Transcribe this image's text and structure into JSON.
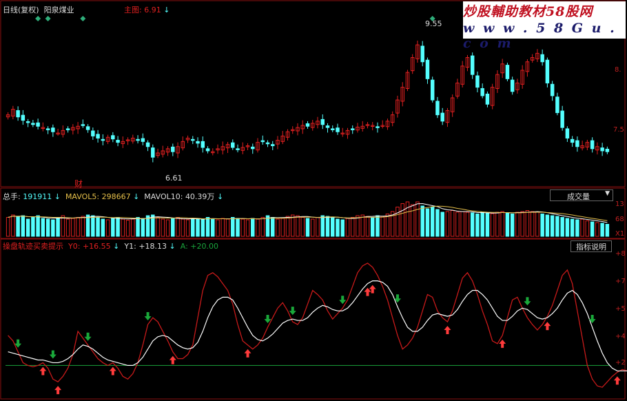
{
  "header": {
    "period": "日线(复权)",
    "stock_name": "阳泉煤业",
    "main_chart_label": "主图",
    "main_chart_value": "6.91",
    "cai_marker": "财"
  },
  "watermark": {
    "line1": "炒股輔助教材58股网",
    "line2": "w w w . 5 8 G u . c o m"
  },
  "price_panel": {
    "high_label": "9.55",
    "low_label": "6.61",
    "axis_labels": [
      "8.",
      "7.5"
    ]
  },
  "volume_panel": {
    "total_label": "总手:",
    "total_value": "191911",
    "mavol5_label": "MAVOL5:",
    "mavol5_value": "298667",
    "mavol10_label": "MAVOL10:",
    "mavol10_value": "40.39万",
    "dropdown_label": "成交量",
    "axis_labels": [
      "13",
      "68",
      "X1"
    ]
  },
  "indicator_panel": {
    "name": "操盘轨迹买卖提示",
    "y0_label": "Y0:",
    "y0_value": "+16.55",
    "y1_label": "Y1:",
    "y1_value": "+18.13",
    "a_label": "A:",
    "a_value": "+20.00",
    "button_label": "指标说明",
    "axis_labels": [
      "+8",
      "+7",
      "+5",
      "+4",
      "+2"
    ]
  },
  "colors": {
    "up": "#e02020",
    "down": "#54ffff",
    "y0_line": "#c81a1a",
    "y1_line": "#ffffff",
    "a_line": "#19a53c",
    "ma_line": "#ffffff",
    "buy_arrow": "#ff3b3b",
    "sell_arrow": "#1aa83a",
    "diamond": "#2fae7a"
  },
  "chart_data": {
    "type": "candlestick",
    "price_ylim": [
      6.3,
      10.2
    ],
    "close": [
      7.85,
      7.98,
      7.8,
      7.72,
      7.68,
      7.62,
      7.58,
      7.55,
      7.5,
      7.45,
      7.42,
      7.48,
      7.52,
      7.55,
      7.58,
      7.6,
      7.5,
      7.35,
      7.3,
      7.25,
      7.32,
      7.28,
      7.2,
      7.22,
      7.26,
      7.3,
      7.25,
      7.22,
      7.1,
      6.85,
      6.95,
      7.0,
      7.05,
      6.98,
      7.1,
      7.22,
      7.3,
      7.25,
      7.18,
      7.08,
      7.0,
      6.98,
      7.05,
      7.1,
      7.15,
      7.08,
      7.04,
      7.08,
      7.12,
      7.05,
      7.2,
      7.22,
      7.18,
      7.12,
      7.25,
      7.35,
      7.45,
      7.5,
      7.55,
      7.6,
      7.58,
      7.65,
      7.7,
      7.62,
      7.55,
      7.5,
      7.45,
      7.42,
      7.48,
      7.52,
      7.56,
      7.58,
      7.62,
      7.6,
      7.55,
      7.6,
      7.7,
      7.85,
      8.2,
      8.5,
      8.85,
      9.2,
      9.5,
      9.1,
      8.7,
      8.2,
      7.85,
      7.7,
      7.95,
      8.25,
      8.6,
      9.0,
      9.2,
      8.8,
      8.5,
      8.3,
      8.1,
      8.5,
      8.8,
      9.05,
      8.7,
      8.4,
      8.6,
      8.9,
      9.1,
      9.2,
      9.3,
      9.1,
      8.6,
      8.3,
      7.9,
      7.55,
      7.3,
      7.2,
      7.1,
      7.12,
      7.2,
      7.05,
      7.1,
      7.0,
      6.98
    ],
    "volume": [
      0.55,
      0.62,
      0.58,
      0.6,
      0.5,
      0.55,
      0.6,
      0.52,
      0.5,
      0.48,
      0.55,
      0.6,
      0.5,
      0.52,
      0.55,
      0.58,
      0.62,
      0.6,
      0.55,
      0.5,
      0.48,
      0.52,
      0.55,
      0.5,
      0.47,
      0.5,
      0.55,
      0.52,
      0.6,
      0.62,
      0.55,
      0.5,
      0.48,
      0.52,
      0.55,
      0.5,
      0.48,
      0.5,
      0.52,
      0.5,
      0.55,
      0.5,
      0.48,
      0.52,
      0.5,
      0.55,
      0.52,
      0.5,
      0.48,
      0.52,
      0.5,
      0.55,
      0.6,
      0.55,
      0.5,
      0.52,
      0.58,
      0.62,
      0.6,
      0.55,
      0.52,
      0.5,
      0.55,
      0.6,
      0.58,
      0.55,
      0.5,
      0.48,
      0.52,
      0.55,
      0.6,
      0.62,
      0.58,
      0.55,
      0.6,
      0.58,
      0.65,
      0.72,
      0.85,
      0.95,
      1.0,
      0.92,
      1.0,
      0.88,
      0.8,
      0.85,
      0.78,
      0.7,
      0.72,
      0.75,
      0.7,
      0.72,
      0.7,
      0.68,
      0.65,
      0.7,
      0.68,
      0.66,
      0.7,
      0.72,
      0.68,
      0.65,
      0.7,
      0.72,
      0.75,
      0.72,
      0.7,
      0.65,
      0.62,
      0.6,
      0.58,
      0.55,
      0.52,
      0.5,
      0.48,
      0.5,
      0.45,
      0.42,
      0.4,
      0.38,
      0.35
    ],
    "indicator_ylim": [
      0,
      100
    ],
    "y0": [
      42,
      38,
      30,
      22,
      20,
      19,
      20,
      22,
      18,
      10,
      8,
      12,
      18,
      28,
      45,
      40,
      35,
      30,
      25,
      22,
      20,
      22,
      18,
      12,
      10,
      14,
      22,
      35,
      50,
      55,
      52,
      45,
      38,
      30,
      25,
      25,
      28,
      35,
      55,
      75,
      86,
      88,
      85,
      80,
      75,
      65,
      50,
      38,
      35,
      32,
      35,
      40,
      48,
      55,
      62,
      66,
      60,
      52,
      50,
      55,
      65,
      75,
      72,
      68,
      60,
      54,
      58,
      62,
      68,
      78,
      88,
      93,
      95,
      92,
      86,
      78,
      68,
      55,
      42,
      32,
      35,
      40,
      48,
      60,
      72,
      70,
      60,
      55,
      52,
      60,
      72,
      84,
      88,
      82,
      72,
      60,
      50,
      38,
      36,
      42,
      55,
      68,
      70,
      62,
      55,
      50,
      46,
      50,
      56,
      64,
      75,
      86,
      90,
      80,
      60,
      40,
      20,
      10,
      5,
      4,
      8,
      12,
      15,
      17,
      16,
      16
    ],
    "y1": [
      30,
      29,
      28,
      27,
      26,
      25,
      24,
      24,
      23,
      22,
      22,
      23,
      25,
      28,
      32,
      35,
      34,
      32,
      29,
      26,
      24,
      23,
      22,
      21,
      20,
      20,
      22,
      26,
      32,
      38,
      41,
      42,
      41,
      38,
      35,
      33,
      32,
      33,
      37,
      45,
      55,
      63,
      68,
      70,
      70,
      68,
      62,
      55,
      48,
      42,
      39,
      38,
      40,
      43,
      47,
      51,
      53,
      54,
      53,
      53,
      55,
      59,
      62,
      64,
      63,
      61,
      60,
      60,
      62,
      66,
      71,
      76,
      80,
      82,
      82,
      81,
      78,
      72,
      63,
      55,
      48,
      45,
      45,
      48,
      53,
      57,
      58,
      57,
      56,
      57,
      61,
      67,
      72,
      75,
      75,
      72,
      68,
      62,
      56,
      53,
      53,
      56,
      60,
      62,
      61,
      58,
      55,
      54,
      55,
      58,
      62,
      68,
      73,
      75,
      72,
      66,
      58,
      48,
      38,
      29,
      22,
      18,
      16,
      16,
      16,
      16
    ],
    "a_value": 20,
    "price_diamonds": [
      6,
      8,
      15,
      85,
      96,
      100
    ],
    "buy_signals": [
      7,
      10,
      21,
      33,
      48,
      72,
      73,
      88,
      99,
      108,
      122
    ],
    "sell_signals": [
      2,
      9,
      16,
      28,
      52,
      57,
      67,
      78,
      104,
      117,
      126
    ],
    "x_count": 125
  }
}
